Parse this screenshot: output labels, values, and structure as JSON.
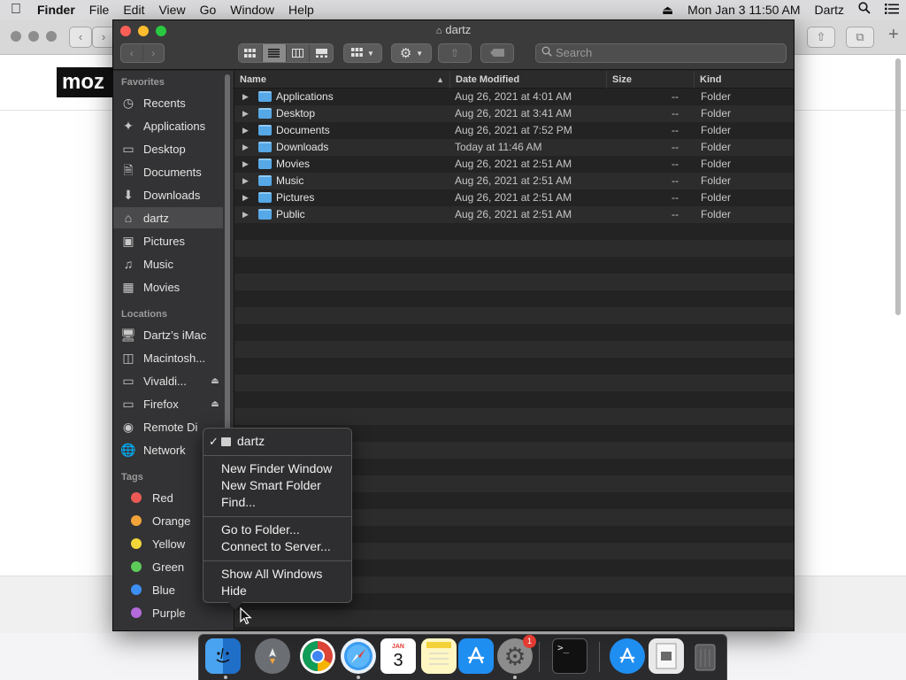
{
  "menubar": {
    "app_name": "Finder",
    "items": [
      "File",
      "Edit",
      "View",
      "Go",
      "Window",
      "Help"
    ],
    "clock": "Mon Jan 3  11:50 AM",
    "user": "Dartz"
  },
  "background_window": {
    "logo_text": "moz"
  },
  "finder": {
    "title": "dartz",
    "search_placeholder": "Search",
    "sidebar": {
      "favorites_header": "Favorites",
      "favorites": [
        {
          "label": "Recents",
          "icon": "clock-icon"
        },
        {
          "label": "Applications",
          "icon": "applications-icon"
        },
        {
          "label": "Desktop",
          "icon": "desktop-icon"
        },
        {
          "label": "Documents",
          "icon": "document-icon"
        },
        {
          "label": "Downloads",
          "icon": "download-icon"
        },
        {
          "label": "dartz",
          "icon": "home-icon",
          "selected": true
        },
        {
          "label": "Pictures",
          "icon": "camera-icon"
        },
        {
          "label": "Music",
          "icon": "music-icon"
        },
        {
          "label": "Movies",
          "icon": "film-icon"
        }
      ],
      "locations_header": "Locations",
      "locations": [
        {
          "label": "Dartz’s iMac",
          "icon": "computer-icon"
        },
        {
          "label": "Macintosh...",
          "icon": "disk-icon"
        },
        {
          "label": "Vivaldi...",
          "icon": "disk-icon",
          "eject": true
        },
        {
          "label": "Firefox",
          "icon": "disk-icon",
          "eject": true
        },
        {
          "label": "Remote Di",
          "icon": "remote-disc-icon"
        },
        {
          "label": "Network",
          "icon": "network-icon"
        }
      ],
      "tags_header": "Tags",
      "tags": [
        {
          "label": "Red",
          "color": "#ec5a55"
        },
        {
          "label": "Orange",
          "color": "#f2a33a"
        },
        {
          "label": "Yellow",
          "color": "#f3d73a"
        },
        {
          "label": "Green",
          "color": "#5ccb5a"
        },
        {
          "label": "Blue",
          "color": "#3d8ef5"
        },
        {
          "label": "Purple",
          "color": "#b36bdb"
        }
      ]
    },
    "columns": {
      "name": "Name",
      "date": "Date Modified",
      "size": "Size",
      "kind": "Kind"
    },
    "rows": [
      {
        "name": "Applications",
        "date": "Aug 26, 2021 at 4:01 AM",
        "size": "--",
        "kind": "Folder"
      },
      {
        "name": "Desktop",
        "date": "Aug 26, 2021 at 3:41 AM",
        "size": "--",
        "kind": "Folder"
      },
      {
        "name": "Documents",
        "date": "Aug 26, 2021 at 7:52 PM",
        "size": "--",
        "kind": "Folder"
      },
      {
        "name": "Downloads",
        "date": "Today at 11:46 AM",
        "size": "--",
        "kind": "Folder"
      },
      {
        "name": "Movies",
        "date": "Aug 26, 2021 at 2:51 AM",
        "size": "--",
        "kind": "Folder"
      },
      {
        "name": "Music",
        "date": "Aug 26, 2021 at 2:51 AM",
        "size": "--",
        "kind": "Folder"
      },
      {
        "name": "Pictures",
        "date": "Aug 26, 2021 at 2:51 AM",
        "size": "--",
        "kind": "Folder"
      },
      {
        "name": "Public",
        "date": "Aug 26, 2021 at 2:51 AM",
        "size": "--",
        "kind": "Folder"
      }
    ]
  },
  "context_menu": {
    "current": "dartz",
    "groups": [
      [
        "New Finder Window",
        "New Smart Folder",
        "Find..."
      ],
      [
        "Go to Folder...",
        "Connect to Server..."
      ],
      [
        "Show All Windows",
        "Hide"
      ]
    ]
  },
  "dock": {
    "apps": [
      "finder-icon",
      "launchpad-icon",
      "chrome-icon",
      "safari-icon",
      "calendar-icon",
      "notes-icon",
      "app-store-icon",
      "system-preferences-icon",
      "terminal-icon",
      "app-store-folder-icon",
      "downloads-stack-icon",
      "trash-icon"
    ],
    "calendar_month": "JAN",
    "calendar_day": "3",
    "system_preferences_badge": "1"
  }
}
